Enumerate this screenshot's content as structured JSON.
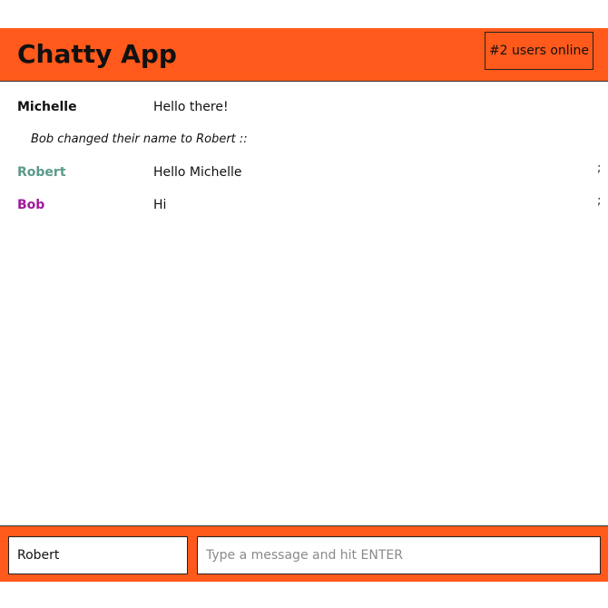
{
  "navbar": {
    "brand": "Chatty App",
    "users_online": "#2 users online",
    "background_color": "#ff5a1b"
  },
  "messages": [
    {
      "username": "Michelle",
      "content": "Hello there!",
      "tail": "",
      "username_color": "#111111"
    },
    {
      "username": "Robert",
      "content": "Hello Michelle",
      "tail": ";",
      "username_color": "#5b9a8b"
    },
    {
      "username": "Bob",
      "content": "Hi",
      "tail": ";",
      "username_color": "#a01a9c"
    }
  ],
  "notification": {
    "text": "Bob changed their name to Robert ::"
  },
  "chatbar": {
    "username_value": "Robert",
    "message_placeholder": "Type a message and hit ENTER"
  }
}
